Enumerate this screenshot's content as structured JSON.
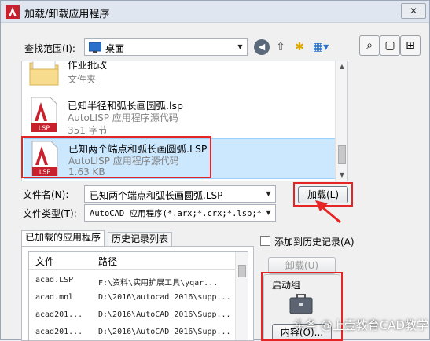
{
  "window": {
    "title": "加载/卸载应用程序",
    "close_glyph": "✕"
  },
  "lookin": {
    "label": "查找范围(I):",
    "value": "桌面"
  },
  "toolbar_icons": [
    "back-icon",
    "up-folder-icon",
    "new-folder-icon",
    "views-icon"
  ],
  "files": [
    {
      "name": "作业批改",
      "subtitle": "文件夹",
      "type": "folder"
    },
    {
      "name": "已知半径和弧长画圆弧.lsp",
      "subtitle": "AutoLISP 应用程序源代码",
      "size": "351 字节",
      "type": "lsp"
    },
    {
      "name": "已知两个端点和弧长画圆弧.LSP",
      "subtitle": "AutoLISP 应用程序源代码",
      "size": "1.63 KB",
      "type": "lsp",
      "selected": true
    }
  ],
  "lsp_badge": "LSP",
  "filename": {
    "label": "文件名(N):",
    "value": "已知两个端点和弧长画圆弧.LSP"
  },
  "filetype": {
    "label": "文件类型(T):",
    "value": "AutoCAD 应用程序(*.arx;*.crx;*.lsp;*"
  },
  "load_button": "加载(L)",
  "tabs": [
    "已加载的应用程序",
    "历史记录列表"
  ],
  "table": {
    "headers": [
      "文件",
      "路径"
    ],
    "rows": [
      {
        "file": "acad.LSP",
        "path": "F:\\资料\\实用扩展工具\\yqar..."
      },
      {
        "file": "acad.mnl",
        "path": "D:\\2016\\autocad 2016\\supp..."
      },
      {
        "file": "acad201...",
        "path": "D:\\2016\\AutoCAD 2016\\Supp..."
      },
      {
        "file": "acad201...",
        "path": "D:\\2016\\AutoCAD 2016\\Supp..."
      }
    ]
  },
  "history_checkbox": "添加到历史记录(A)",
  "unload_button": "卸载(U)",
  "startup": {
    "label": "启动组",
    "contents_button": "内容(O)..."
  },
  "watermark": "头条 @上壹教育CAD教学",
  "colors": {
    "highlight": "#e52525",
    "selected_bg": "#cce8ff"
  }
}
